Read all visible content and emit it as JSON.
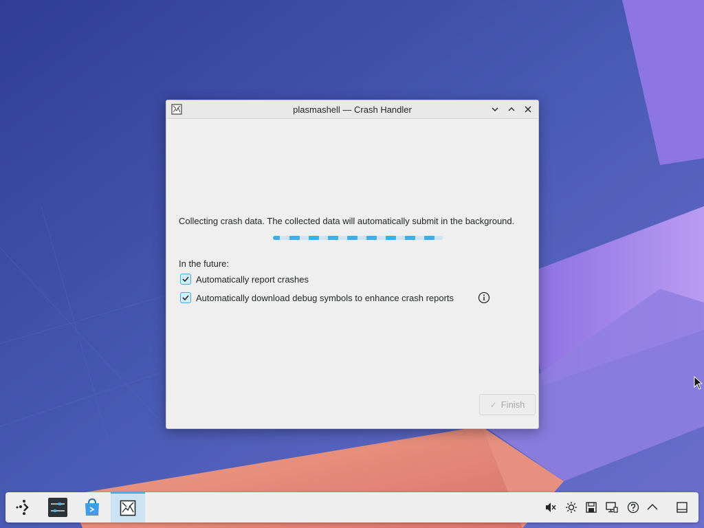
{
  "window": {
    "title": "plasmashell — Crash Handler",
    "message": "Collecting crash data. The collected data will automatically submit in the background.",
    "future_label": "In the future:",
    "options": [
      {
        "label": "Automatically report crashes",
        "checked": true
      },
      {
        "label": "Automatically download debug symbols to enhance crash reports",
        "checked": true
      }
    ],
    "finish_label": "Finish",
    "finish_enabled": false,
    "progress_indeterminate": true
  },
  "taskbar": {
    "apps": [
      "application-launcher-icon",
      "system-settings-icon",
      "discover-icon",
      "crash-handler-icon"
    ],
    "tray": [
      "volume-muted-icon",
      "brightness-icon",
      "save-icon",
      "display-icon",
      "help-icon",
      "chevron-up-icon",
      "show-desktop-icon"
    ]
  },
  "colors": {
    "accent": "#3daee9",
    "window_bg": "#efefef",
    "text": "#232627"
  }
}
